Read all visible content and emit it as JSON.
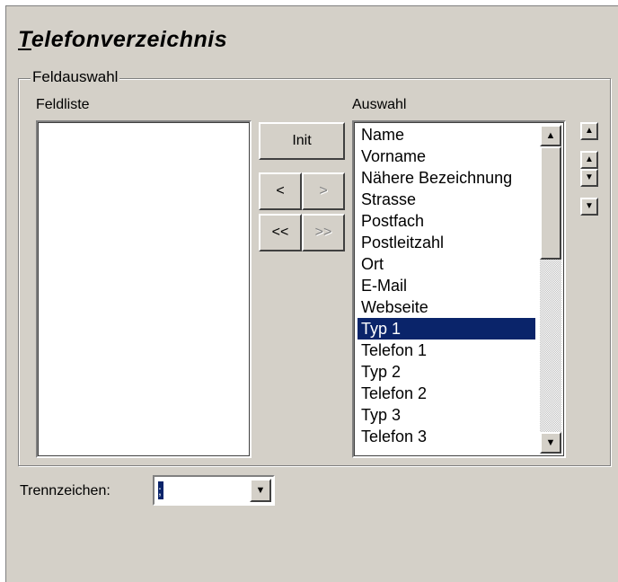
{
  "title": {
    "first": "T",
    "rest": "elefonverzeichnis"
  },
  "group_label": "Feldauswahl",
  "field_list_label": "Feldliste",
  "selection_label": "Auswahl",
  "buttons": {
    "init": "Init",
    "remove": "<",
    "add": ">",
    "remove_all": "<<",
    "add_all": ">>"
  },
  "selection_items": [
    "Name",
    "Vorname",
    "Nähere Bezeichnung",
    "Strasse",
    "Postfach",
    "Postleitzahl",
    "Ort",
    "E-Mail",
    "Webseite",
    "Typ 1",
    "Telefon 1",
    "Typ 2",
    "Telefon 2",
    "Typ 3",
    "Telefon 3"
  ],
  "selected_index": 9,
  "separator_label": "Trennzeichen:",
  "separator_value": ";",
  "icons": {
    "scroll_up": "▲",
    "scroll_down": "▼",
    "move_top": "▲",
    "move_up": "▲",
    "move_down": "▼",
    "move_bottom": "▼",
    "combo_arrow": "▼"
  }
}
